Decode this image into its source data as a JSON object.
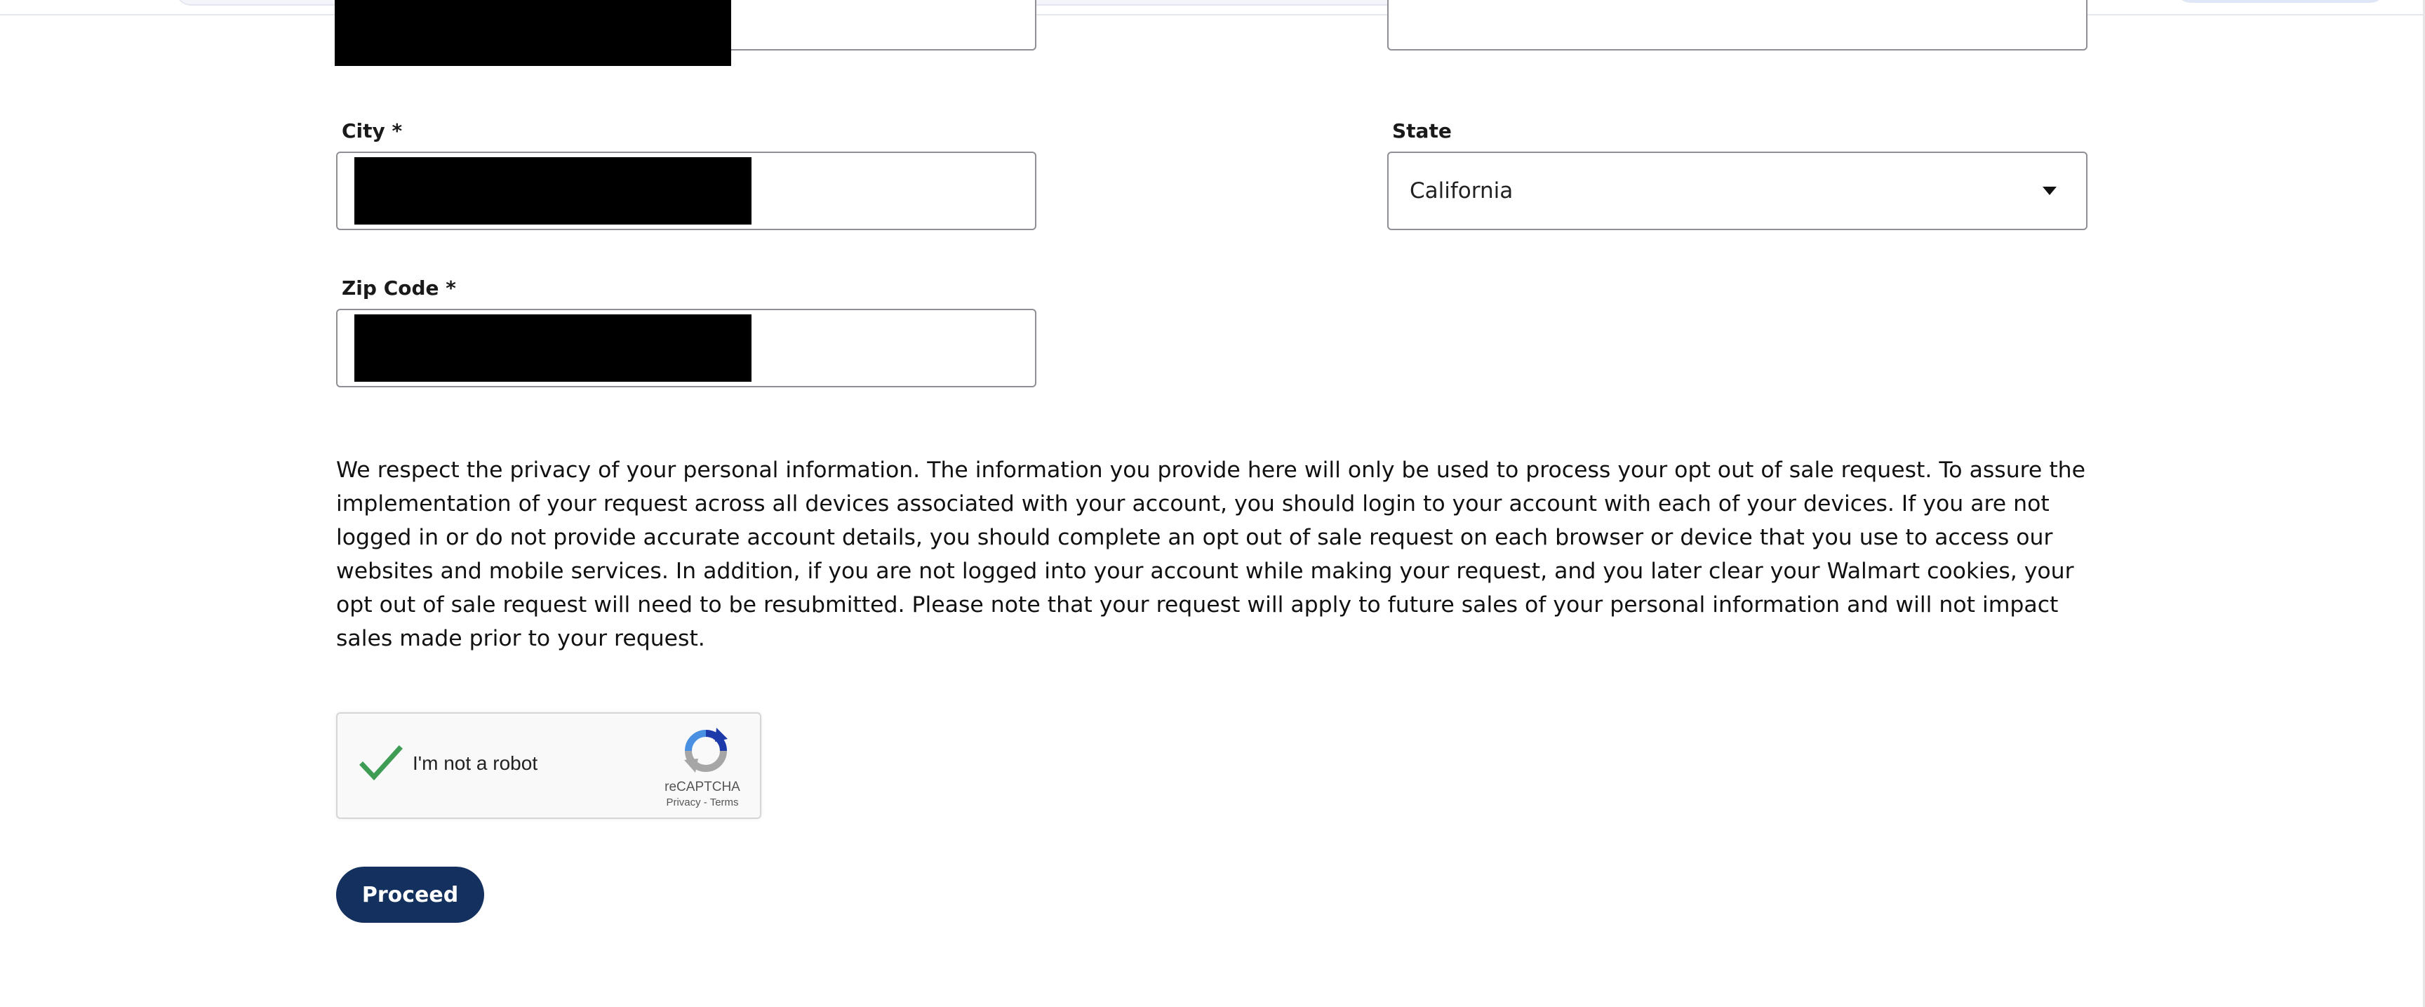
{
  "form": {
    "city": {
      "label": "City *",
      "value": ""
    },
    "state": {
      "label": "State",
      "value": "California"
    },
    "zip": {
      "label": "Zip Code *",
      "value": ""
    }
  },
  "privacy_notice": "We respect the privacy of your personal information. The information you provide here will only be used to process your opt out of sale request. To assure the implementation of your request across all devices associated with your account, you should login to your account with each of your devices. If you are not logged in or do not provide accurate account details, you should complete an opt out of sale request on each browser or device that you use to access our websites and mobile services. In addition, if you are not logged into your account while making your request, and you later clear your Walmart cookies, your opt out of sale request will need to be resubmitted. Please note that your request will apply to future sales of your personal information and will not impact sales made prior to your request.",
  "recaptcha": {
    "checked": true,
    "label": "I'm not a robot",
    "brand": "reCAPTCHA",
    "privacy_link": "Privacy",
    "separator": "-",
    "terms_link": "Terms"
  },
  "actions": {
    "proceed_label": "Proceed"
  },
  "colors": {
    "primary_button": "#13305f",
    "check_green": "#3f9c54",
    "input_border": "#8f8f95"
  }
}
